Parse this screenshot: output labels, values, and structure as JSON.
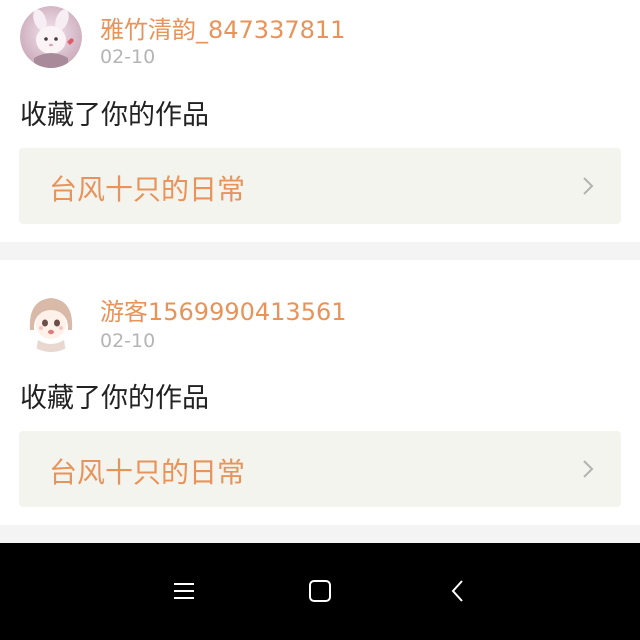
{
  "notifications": [
    {
      "username": "雅竹清韵_847337811",
      "date": "02-10",
      "action": "收藏了你的作品",
      "work_title": "台风十只的日常"
    },
    {
      "username": "游客1569990413561",
      "date": "02-10",
      "action": "收藏了你的作品",
      "work_title": "台风十只的日常"
    }
  ],
  "icons": {
    "chevron": "chevron-right-icon",
    "menu": "menu-icon",
    "home": "home-icon",
    "back": "back-icon"
  },
  "colors": {
    "accent": "#e8935a",
    "date": "#b5b5b5",
    "text": "#222222",
    "card_link_bg": "#f4f4ee",
    "separator": "#f4f4f4",
    "navbar": "#000000"
  }
}
